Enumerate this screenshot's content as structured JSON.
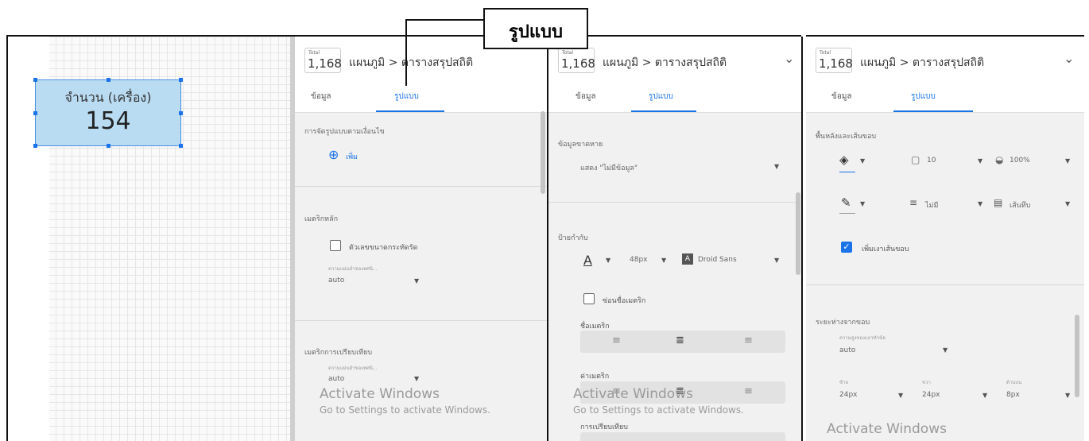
{
  "callout": {
    "label": "รูปแบบ"
  },
  "canvas": {
    "scorecard": {
      "label": "จำนวน (เครื่อง)",
      "value": "154"
    }
  },
  "common": {
    "total_label": "Total",
    "total_value": "1,168",
    "breadcrumb": "แผนภูมิ > ตารางสรุปสถิติ",
    "tab_data": "ข้อมูล",
    "tab_style": "รูปแบบ"
  },
  "panel1": {
    "conditional_formatting": "การจัดรูปแบบตามเงื่อนไข",
    "add_label": "เพิ่ม",
    "primary_metric": "เมตริกหลัก",
    "compact_numbers": "ตัวเลขขนาดกระทัดรัด",
    "decimal_precision_label": "ความแม่นยำของทศนิ...",
    "decimal_precision_value": "auto",
    "comparison_metric": "เมตริกการเปรียบเทียบ",
    "comparison_precision_label": "ความแม่นยำของทศนิ...",
    "comparison_precision_value": "auto"
  },
  "panel2": {
    "missing_data": "ข้อมูลขาดหาย",
    "missing_data_value": "แสดง \"ไม่มีข้อมูล\"",
    "labels": "ป้ายกำกับ",
    "font_size": "48px",
    "font_family": "Droid Sans",
    "hide_metric_name": "ซ่อนชื่อเมตริก",
    "metric_name": "ชื่อเมตริก",
    "metric_value": "ค่าเมตริก",
    "comparison": "การเปรียบเทียบ"
  },
  "panel3": {
    "background_border": "พื้นหลังและเส้นขอบ",
    "radius": "10",
    "opacity": "100%",
    "border_weight": "ไม่มี",
    "border_style": "เส้นทึบ",
    "add_border_shadow": "เพิ่มเงาเส้นขอบ",
    "padding": "ระยะห่างจากขอบ",
    "padding_mode_label": "ความสูงของแถวหัวข้อ",
    "padding_mode_value": "auto",
    "left_label": "ซ้าย",
    "left_value": "24px",
    "right_label": "ขวา",
    "right_value": "24px",
    "top_label": "ด้านบน",
    "top_value": "8px"
  },
  "watermark": {
    "title": "Activate Windows",
    "subtitle": "Go to Settings to activate Windows."
  }
}
